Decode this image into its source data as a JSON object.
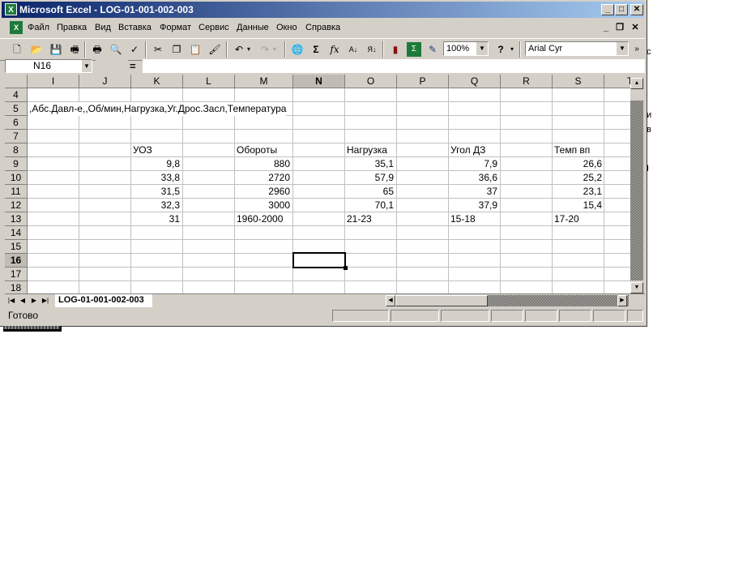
{
  "window": {
    "title": "Microsoft Excel - LOG-01-001-002-003",
    "app_icon": "excel-icon"
  },
  "caption_buttons": {
    "minimize": "_",
    "maximize": "□",
    "close": "✕"
  },
  "menu": [
    "Файл",
    "Правка",
    "Вид",
    "Вставка",
    "Формат",
    "Сервис",
    "Данные",
    "Окно",
    "Справка"
  ],
  "mdi_buttons": {
    "minimize": "_",
    "restore": "❐",
    "close": "✕"
  },
  "toolbar": {
    "zoom": "100%",
    "font": "Arial Cyr",
    "icons": [
      "new-icon",
      "open-icon",
      "save-icon",
      "permission-icon",
      "print-icon",
      "print-preview-icon",
      "spelling-icon",
      "cut-icon",
      "copy-icon",
      "paste-icon",
      "format-painter-icon",
      "undo-icon",
      "redo-icon",
      "hyperlink-icon",
      "autosum-icon",
      "function-icon",
      "sort-ascending-icon",
      "sort-descending-icon",
      "chart-wizard-icon",
      "map-icon",
      "drawing-icon",
      "help-icon"
    ]
  },
  "formula_bar": {
    "name_box": "N16",
    "equals": "=",
    "content": ""
  },
  "columns": [
    "I",
    "J",
    "K",
    "L",
    "M",
    "N",
    "O",
    "P",
    "Q",
    "R",
    "S",
    "T"
  ],
  "selected_column": "N",
  "rows": [
    "4",
    "5",
    "6",
    "7",
    "8",
    "9",
    "10",
    "11",
    "12",
    "13",
    "14",
    "15",
    "16",
    "17",
    "18"
  ],
  "selected_row": "16",
  "cells": {
    "row5": {
      "I": ",Абс.Давл-е,,Об/мин,Нагрузка,Уг.Дрос.Засл,Температура"
    },
    "row8": {
      "K": "УОЗ",
      "M": "Обороты",
      "O": "Нагрузка",
      "Q": "Угол ДЗ",
      "S": "Темп вп"
    },
    "row9": {
      "K": "9,8",
      "M": "880",
      "O": "35,1",
      "Q": "7,9",
      "S": "26,6"
    },
    "row10": {
      "K": "33,8",
      "M": "2720",
      "O": "57,9",
      "Q": "36,6",
      "S": "25,2"
    },
    "row11": {
      "K": "31,5",
      "M": "2960",
      "O": "65",
      "Q": "37",
      "S": "23,1"
    },
    "row12": {
      "K": "32,3",
      "M": "3000",
      "O": "70,1",
      "Q": "37,9",
      "S": "15,4"
    },
    "row13": {
      "K": "31",
      "M": "1960-2000",
      "O": "21-23",
      "Q": "15-18",
      "S": "17-20"
    }
  },
  "sheet_tabs": [
    "LOG-01-001-002-003"
  ],
  "status": "Готово",
  "background_fragments": [
    "c",
    "и",
    "в",
    "I"
  ]
}
